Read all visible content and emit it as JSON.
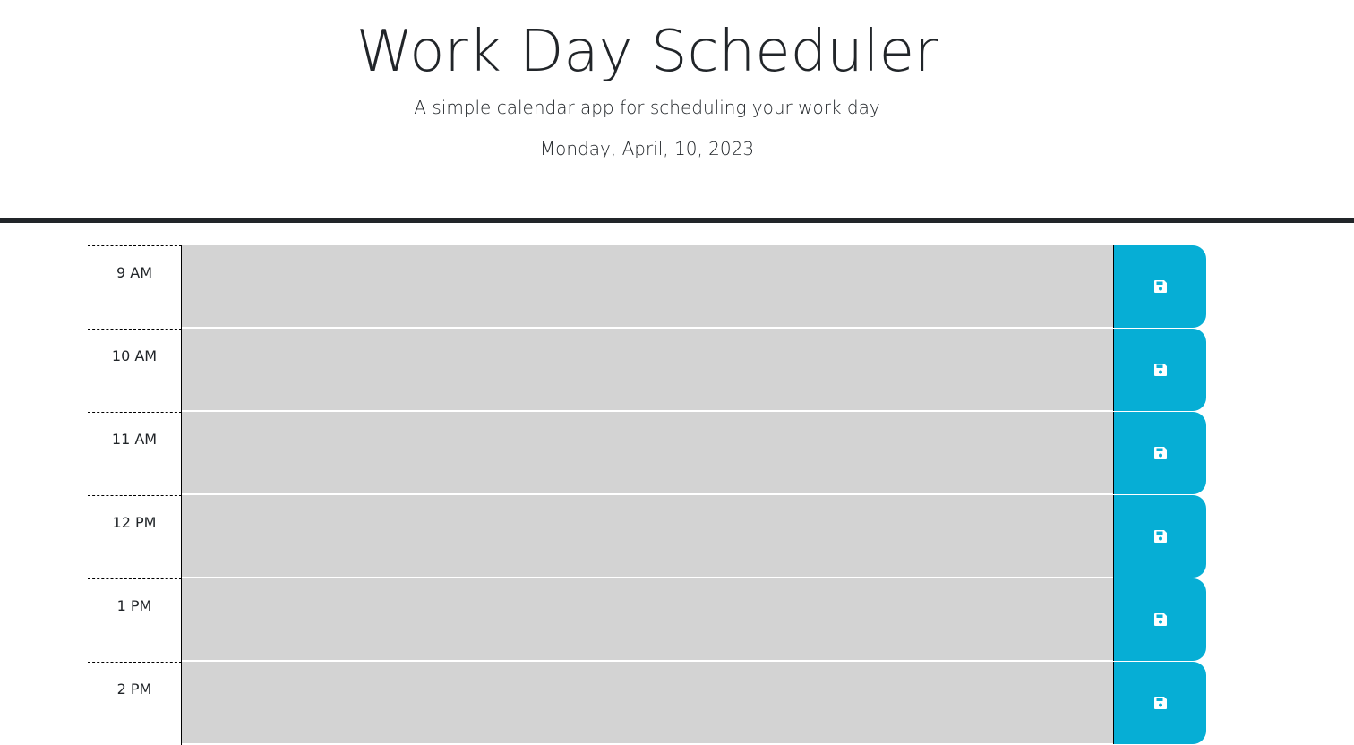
{
  "header": {
    "title": "Work Day Scheduler",
    "subtitle": "A simple calendar app for scheduling your work day",
    "current_day": "Monday, April, 10, 2023"
  },
  "time_blocks": [
    {
      "hour": "9 AM",
      "description": "",
      "save_icon": "floppy-disk-icon"
    },
    {
      "hour": "10 AM",
      "description": "",
      "save_icon": "floppy-disk-icon"
    },
    {
      "hour": "11 AM",
      "description": "",
      "save_icon": "floppy-disk-icon"
    },
    {
      "hour": "12 PM",
      "description": "",
      "save_icon": "floppy-disk-icon"
    },
    {
      "hour": "1 PM",
      "description": "",
      "save_icon": "floppy-disk-icon"
    },
    {
      "hour": "2 PM",
      "description": "",
      "save_icon": "floppy-disk-icon"
    }
  ],
  "colors": {
    "textarea_background": "#d3d3d3",
    "save_button": "#06aed5",
    "header_border": "#212529",
    "text": "#212529"
  }
}
